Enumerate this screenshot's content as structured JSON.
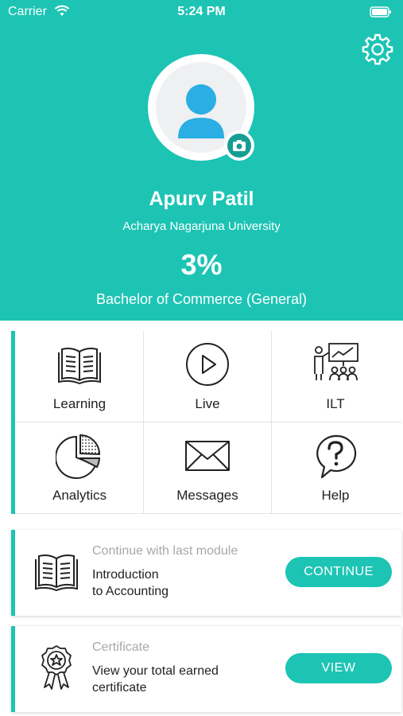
{
  "status_bar": {
    "carrier": "Carrier",
    "time": "5:24 PM"
  },
  "profile": {
    "name": "Apurv Patil",
    "university": "Acharya Nagarjuna University",
    "progress": "3%",
    "degree": "Bachelor of Commerce (General)"
  },
  "menu": {
    "items": [
      {
        "label": "Learning",
        "icon": "book-icon"
      },
      {
        "label": "Live",
        "icon": "play-icon"
      },
      {
        "label": "ILT",
        "icon": "presentation-icon"
      },
      {
        "label": "Analytics",
        "icon": "pie-chart-icon"
      },
      {
        "label": "Messages",
        "icon": "envelope-icon"
      },
      {
        "label": "Help",
        "icon": "question-bubble-icon"
      }
    ]
  },
  "continue_card": {
    "title": "Continue with last module",
    "text_line1": "Introduction",
    "text_line2": "to Accounting",
    "button": "CONTINUE"
  },
  "certificate_card": {
    "title": "Certificate",
    "text_line1": "View your total earned",
    "text_line2": "certificate",
    "button": "VIEW"
  },
  "colors": {
    "accent": "#1dc4b4",
    "accent_dark": "#159e93",
    "avatar_blue": "#2aaee3"
  }
}
